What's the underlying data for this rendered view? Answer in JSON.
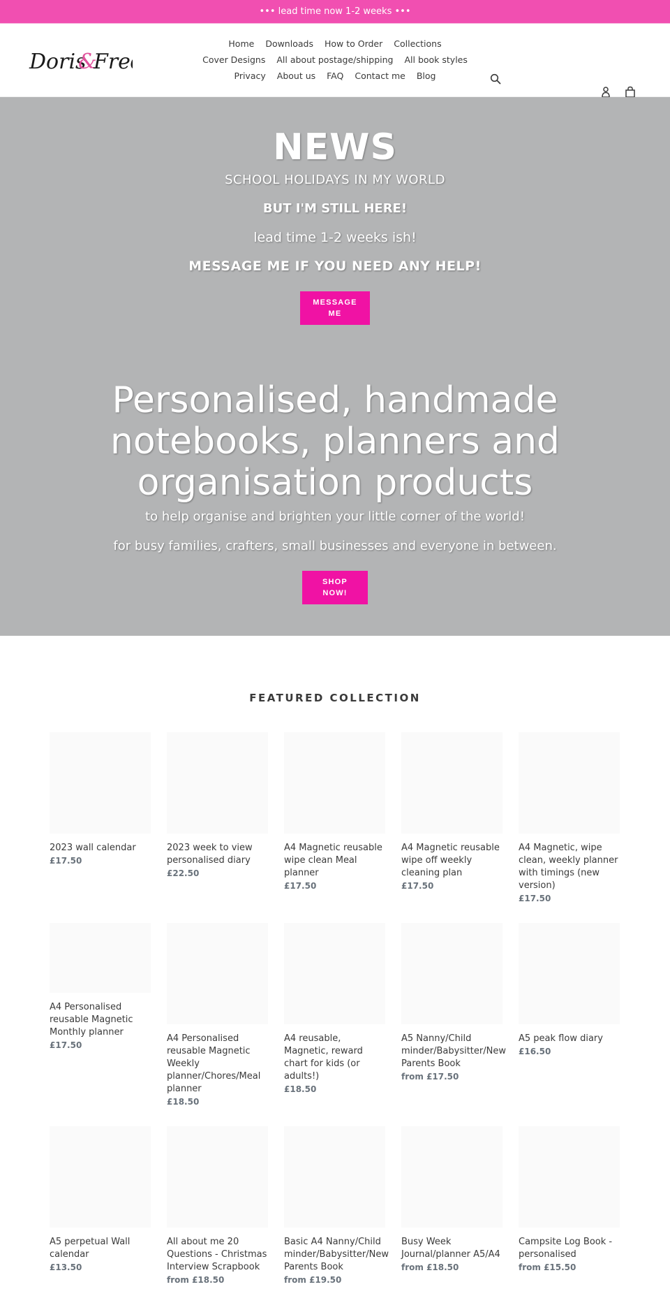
{
  "announcement": "••• lead time now 1-2 weeks •••",
  "brand": {
    "logo_text_left": "Doris",
    "logo_ampersand": "&",
    "logo_text_right": "Fred",
    "accent_color": "#f012a4",
    "announcement_color": "#f14fb1"
  },
  "nav": {
    "items": [
      {
        "label": "Home"
      },
      {
        "label": "Downloads"
      },
      {
        "label": "How to Order"
      },
      {
        "label": "Collections"
      },
      {
        "label": "Cover Designs"
      },
      {
        "label": "All about postage/shipping"
      },
      {
        "label": "All book styles"
      },
      {
        "label": "Privacy"
      },
      {
        "label": "About us"
      },
      {
        "label": "FAQ"
      },
      {
        "label": "Contact me"
      },
      {
        "label": "Blog"
      }
    ],
    "icons": {
      "search": "search-icon",
      "account": "user-icon",
      "cart": "shopping-bag-icon"
    }
  },
  "hero": {
    "news_title": "NEWS",
    "news_lines": [
      "SCHOOL HOLIDAYS IN MY WORLD",
      "BUT I'M STILL HERE!",
      "lead time 1-2 weeks ish!",
      "MESSAGE ME IF YOU NEED ANY HELP!"
    ],
    "message_button": "MESSAGE ME",
    "headline": "Personalised, handmade notebooks, planners and organisation products",
    "subline_1": "to help organise and brighten your little corner of the world!",
    "subline_2": "for busy families, crafters, small businesses and everyone in between.",
    "shop_button": "SHOP NOW!"
  },
  "featured": {
    "title": "FEATURED COLLECTION",
    "products": [
      {
        "title": "2023 wall calendar",
        "price": "£17.50"
      },
      {
        "title": "2023 week to view personalised diary",
        "price": "£22.50"
      },
      {
        "title": "A4 Magnetic reusable wipe clean Meal planner",
        "price": "£17.50"
      },
      {
        "title": "A4 Magnetic reusable wipe off weekly cleaning plan",
        "price": "£17.50"
      },
      {
        "title": "A4 Magnetic, wipe clean, weekly planner with timings (new version)",
        "price": "£17.50"
      },
      {
        "title": "A4 Personalised reusable Magnetic Monthly planner",
        "price": "£17.50"
      },
      {
        "title": "A4 Personalised reusable Magnetic Weekly planner/Chores/Meal planner",
        "price": "£18.50"
      },
      {
        "title": "A4 reusable, Magnetic, reward chart for kids (or adults!)",
        "price": "£18.50"
      },
      {
        "title": "A5 Nanny/Child minder/Babysitter/New Parents Book",
        "price": "from £17.50"
      },
      {
        "title": "A5 peak flow diary",
        "price": "£16.50"
      },
      {
        "title": "A5 perpetual Wall calendar",
        "price": "£13.50"
      },
      {
        "title": "All about me 20 Questions - Christmas Interview Scrapbook",
        "price": "from £18.50"
      },
      {
        "title": "Basic A4 Nanny/Child minder/Babysitter/New Parents Book",
        "price": "from £19.50"
      },
      {
        "title": "Busy Week Journal/planner A5/A4",
        "price": "from £18.50"
      },
      {
        "title": "Campsite Log Book - personalised",
        "price": "from £15.50"
      }
    ]
  }
}
